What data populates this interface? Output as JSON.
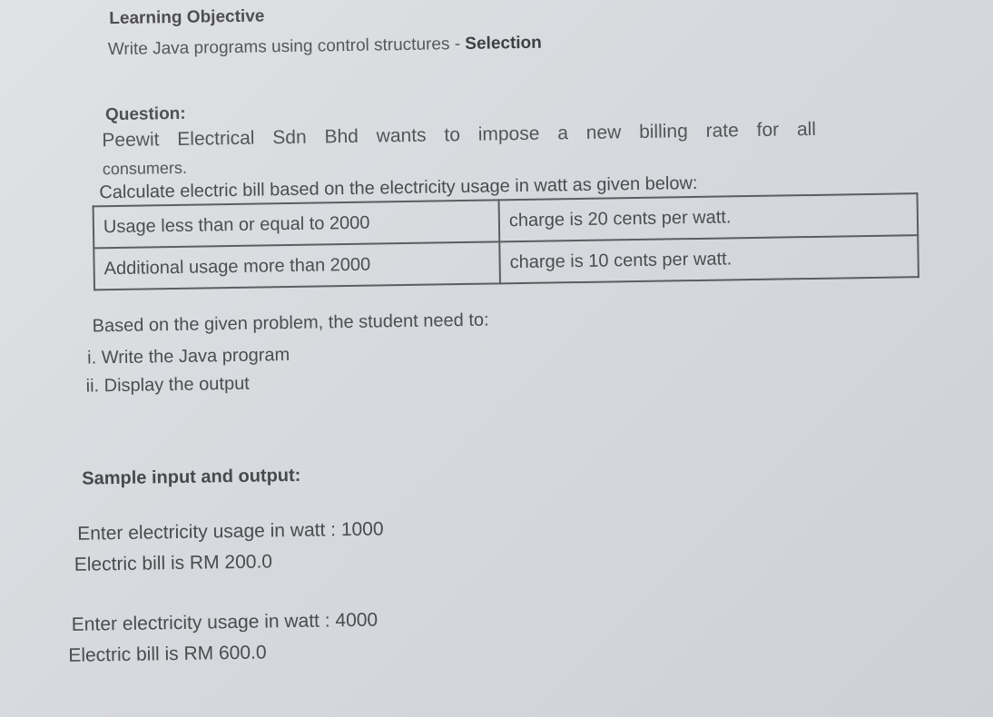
{
  "learning_objective": {
    "heading": "Learning Objective",
    "text_prefix": "Write Java programs using control structures - ",
    "text_bold": "Selection"
  },
  "question": {
    "heading": "Question:",
    "text_line1": "Peewit Electrical Sdn Bhd wants to impose a new billing rate for all",
    "text_line2": "consumers.",
    "instruction": "Calculate electric bill based on the electricity usage in watt as given below:"
  },
  "rate_table": {
    "rows": [
      {
        "condition": "Usage less than or equal to 2000",
        "charge": "charge is 20 cents per watt."
      },
      {
        "condition": "Additional usage more than 2000",
        "charge": "charge is 10 cents per watt."
      }
    ]
  },
  "tasks": {
    "intro": "Based on the given problem, the student need to:",
    "items": [
      "i. Write the Java program",
      "ii. Display the output"
    ]
  },
  "sample": {
    "heading": "Sample input and output:",
    "cases": [
      {
        "input": "Enter electricity usage in watt : 1000",
        "output": "Electric bill is RM 200.0"
      },
      {
        "input": "Enter electricity usage in watt : 4000",
        "output": "Electric bill is RM 600.0"
      }
    ]
  }
}
